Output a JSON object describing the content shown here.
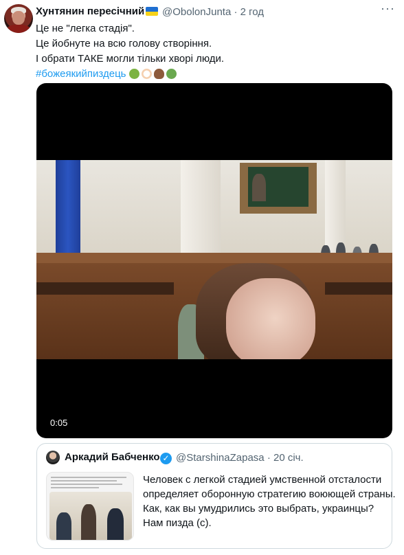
{
  "tweet": {
    "author_name": "Хунтянин пересічний",
    "handle": "@ObolonJunta",
    "time": "· 2 год",
    "more_label": "···",
    "lines": [
      "Це не \"легка стадія\".",
      "Це йобнуте на всю голову створіння.",
      "І обрати ТАКЕ могли тільки хворі люди."
    ],
    "hashtag": "#божеякийпиздець",
    "emoji_names": [
      "nauseated-face",
      "clown-face",
      "pile-of-poo",
      "face-vomiting"
    ],
    "emoji_colors": [
      "#7cb342",
      "#f5d0b0",
      "#8d5a3b",
      "#6aa84f"
    ]
  },
  "video": {
    "timestamp": "0:05"
  },
  "quoted": {
    "author_name": "Аркадий Бабченко",
    "handle": "@StarshinaZapasa",
    "time": "· 20 січ.",
    "lines": [
      "Человек с легкой стадией умственной отсталости",
      "определяет оборонную стратегию воюющей страны.",
      "Как, как вы умудрились это выбрать, украинцы?",
      "Нам пизда (с)."
    ]
  },
  "colors": {
    "text": "#0f1419",
    "muted": "#536471",
    "accent": "#1d9bf0",
    "border": "#cfd9de"
  }
}
